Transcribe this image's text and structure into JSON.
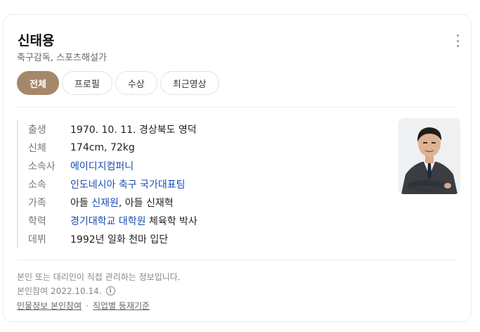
{
  "profile": {
    "name": "신태용",
    "occupation": "축구감독, 스포츠해설가"
  },
  "tabs": [
    {
      "label": "전체",
      "active": true
    },
    {
      "label": "프로필",
      "active": false
    },
    {
      "label": "수상",
      "active": false
    },
    {
      "label": "최근영상",
      "active": false
    }
  ],
  "info": {
    "birth": {
      "key": "출생",
      "value": "1970. 10. 11. 경상북도 영덕"
    },
    "body": {
      "key": "신체",
      "value": "174cm, 72kg"
    },
    "agency": {
      "key": "소속사",
      "value": "에이디지컴퍼니"
    },
    "team": {
      "key": "소속",
      "value": "인도네시아 축구 국가대표팀"
    },
    "family": {
      "key": "가족",
      "prefix": "아들 ",
      "link": "신재원",
      "suffix": ", 아들 신재혁"
    },
    "education": {
      "key": "학력",
      "link": "경기대학교 대학원",
      "suffix": " 체육학 박사"
    },
    "debut": {
      "key": "데뷔",
      "value": "1992년 일화 천마 입단"
    }
  },
  "footer": {
    "notice": "본인 또는 대리인이 직접 관리하는 정보입니다.",
    "participation_label": "본인참여",
    "participation_date": "2022.10.14.",
    "link1": "인물정보 본인참여",
    "separator": "·",
    "link2": "직업별 등재기준"
  },
  "colors": {
    "active_tab": "#a58869",
    "link": "#1a4eb0"
  },
  "icons": [
    "more-vertical-icon",
    "info-icon"
  ]
}
